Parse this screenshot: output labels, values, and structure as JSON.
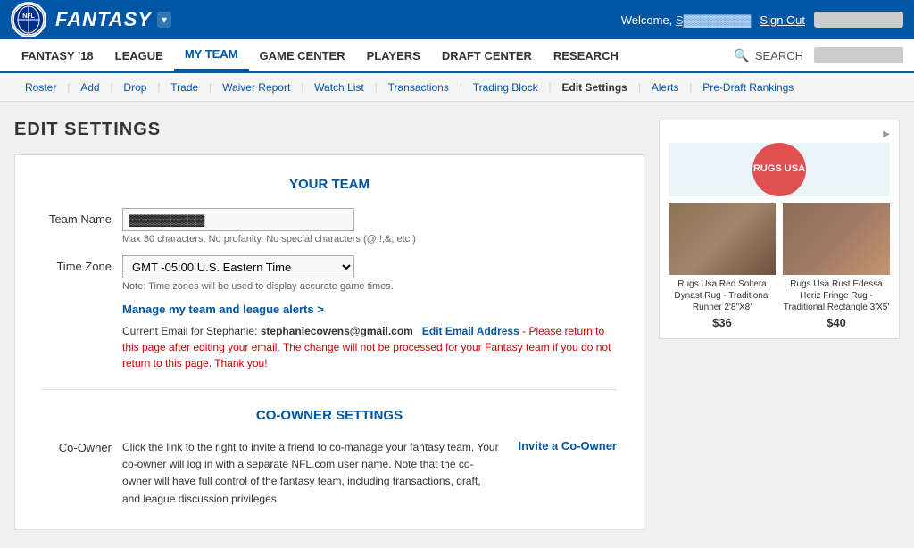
{
  "topbar": {
    "fantasy_label": "FANTASY",
    "dropdown_symbol": "▾",
    "welcome_text": "Welcome,",
    "welcome_name": "S▓▓▓▓▓▓▓▓",
    "sign_out": "Sign Out",
    "team_name_placeholder": "▓▓▓▓▓▓▓▓"
  },
  "nav": {
    "items": [
      {
        "id": "fantasy18",
        "label": "FANTASY '18",
        "active": false
      },
      {
        "id": "league",
        "label": "LEAGUE",
        "active": false
      },
      {
        "id": "my-team",
        "label": "MY TEAM",
        "active": true
      },
      {
        "id": "game-center",
        "label": "GAME CENTER",
        "active": false
      },
      {
        "id": "players",
        "label": "PLAYERS",
        "active": false
      },
      {
        "id": "draft-center",
        "label": "DRAFT CENTER",
        "active": false
      },
      {
        "id": "research",
        "label": "RESEARCH",
        "active": false
      }
    ],
    "search_label": "SEARCH"
  },
  "subnav": {
    "items": [
      {
        "id": "roster",
        "label": "Roster",
        "active": false
      },
      {
        "id": "add",
        "label": "Add",
        "active": false
      },
      {
        "id": "drop",
        "label": "Drop",
        "active": false
      },
      {
        "id": "trade",
        "label": "Trade",
        "active": false
      },
      {
        "id": "waiver-report",
        "label": "Waiver Report",
        "active": false
      },
      {
        "id": "watch-list",
        "label": "Watch List",
        "active": false
      },
      {
        "id": "transactions",
        "label": "Transactions",
        "active": false
      },
      {
        "id": "trading-block",
        "label": "Trading Block",
        "active": false
      },
      {
        "id": "edit-settings",
        "label": "Edit Settings",
        "active": true
      },
      {
        "id": "alerts",
        "label": "Alerts",
        "active": false
      },
      {
        "id": "pre-draft-rankings",
        "label": "Pre-Draft Rankings",
        "active": false
      }
    ]
  },
  "page": {
    "title": "EDIT SETTINGS"
  },
  "your_team": {
    "section_title": "YOUR TEAM",
    "team_name_label": "Team Name",
    "team_name_value": "▓▓▓▓▓▓▓▓▓",
    "team_name_hint": "Max 30 characters. No profanity. No special characters (@,!,&, etc.)",
    "timezone_label": "Time Zone",
    "timezone_value": "GMT -05:00 U.S. Eastern Time",
    "timezone_hint": "Note: Time zones will be used to display accurate game times.",
    "manage_link": "Manage my team and league alerts >",
    "email_prefix": "Current Email for Stephanie:",
    "email_address": "stephaniecowens@gmail.com",
    "edit_email_label": "Edit Email Address",
    "edit_email_note": "- Please return to this page after editing your email. The change will not be processed for your Fantasy team if you do not return to this page. Thank you!"
  },
  "co_owner": {
    "section_title": "CO-OWNER SETTINGS",
    "label": "Co-Owner",
    "description": "Click the link to the right to invite a friend to co-manage your fantasy team. Your co-owner will log in with a separate NFL.com user name. Note that the co-owner will have full control of the fantasy team, including transactions, draft, and league discussion privileges.",
    "invite_label": "Invite a Co-Owner"
  },
  "ad": {
    "ad_label": "▶",
    "brand_name": "RUGS USA",
    "products": [
      {
        "name": "Rugs Usa Red Soltera Dynast Rug - Traditional Runner 2'8\"X8'",
        "price": "$36"
      },
      {
        "name": "Rugs Usa Rust Edessa Heriz Fringe Rug - Traditional Rectangle 3'X5'",
        "price": "$40"
      }
    ]
  }
}
